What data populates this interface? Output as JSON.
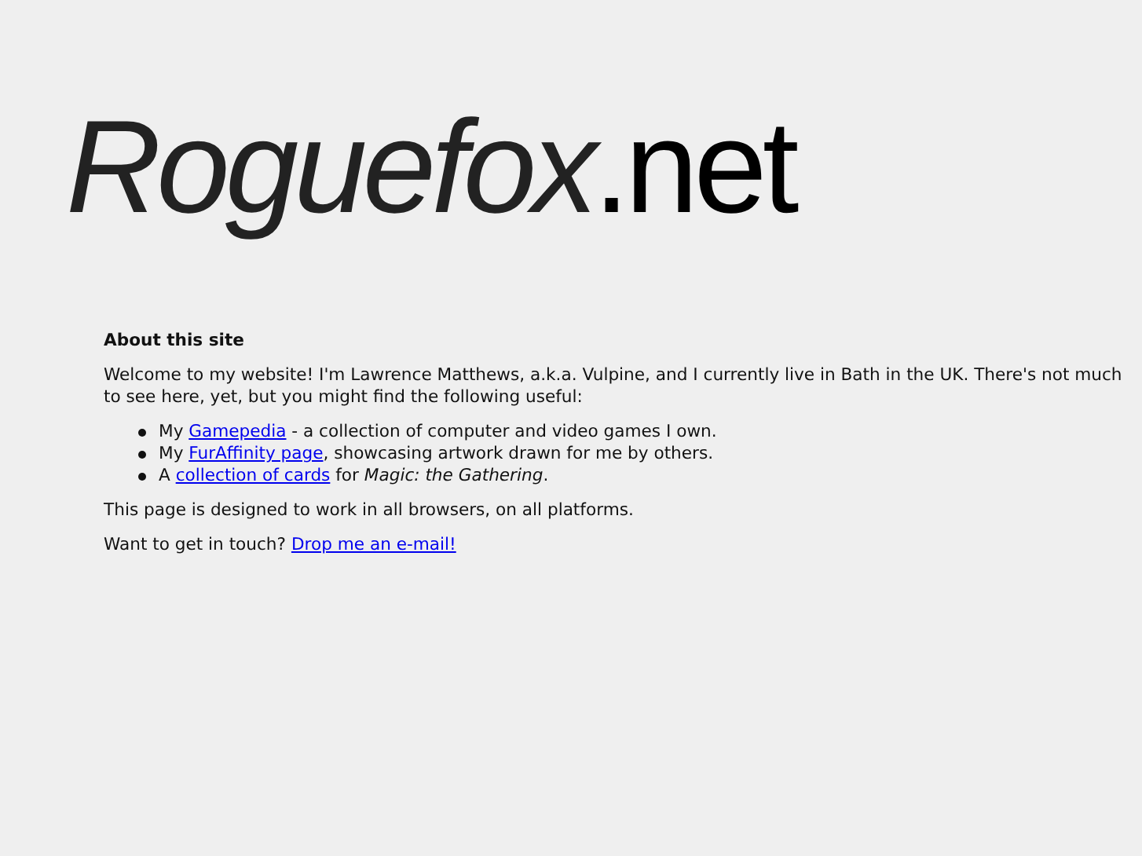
{
  "logo": {
    "name": "Roguefox",
    "suffix": ".net"
  },
  "heading": "About this site",
  "intro": "Welcome to my website! I'm Lawrence Matthews, a.k.a. Vulpine, and I currently live in Bath in the UK. There's not much to see here, yet, but you might find the following useful:",
  "links": [
    {
      "before": "My ",
      "link": "Gamepedia",
      "after": " - a collection of computer and video games I own."
    },
    {
      "before": "My ",
      "link": "FurAffinity page",
      "after": ", showcasing artwork drawn for me by others."
    },
    {
      "before": "A ",
      "link": "collection of cards",
      "after": " for *Magic: the Gathering*."
    }
  ],
  "note": "This page is designed to work in all browsers, on all platforms.",
  "contact": {
    "before": "Want to get in touch? ",
    "link": "Drop me an e-mail!"
  }
}
